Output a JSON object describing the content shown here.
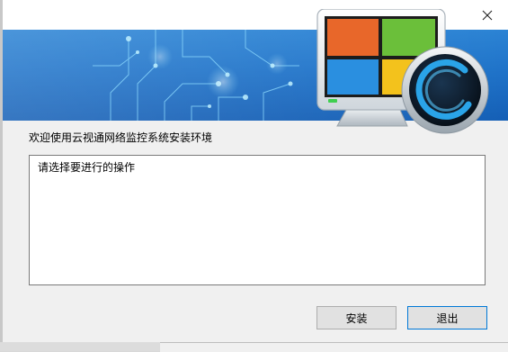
{
  "window": {
    "close_icon": "close-icon"
  },
  "banner": {
    "art_icon": "monitor-windows-logo-icon"
  },
  "welcome_text": "欢迎使用云视通网络监控系统安装环境",
  "log": {
    "lines": [
      "请选择要进行的操作"
    ]
  },
  "buttons": {
    "install_label": "安装",
    "exit_label": "退出"
  },
  "colors": {
    "banner": "#1f73c9",
    "focus_border": "#0078d7"
  }
}
